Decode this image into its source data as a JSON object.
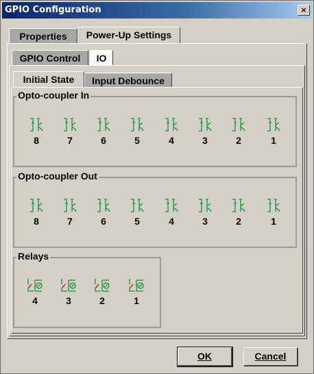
{
  "window": {
    "title": "GPIO Configuration",
    "close_label": "×"
  },
  "tabs": {
    "top": [
      {
        "label": "Properties"
      },
      {
        "label": "Power-Up Settings"
      }
    ],
    "second": [
      {
        "label": "GPIO Control"
      },
      {
        "label": "IO"
      }
    ],
    "third": [
      {
        "label": "Initial State"
      },
      {
        "label": "Input Debounce"
      }
    ]
  },
  "groups": {
    "opto_in": {
      "title": "Opto-coupler In",
      "items": [
        "8",
        "7",
        "6",
        "5",
        "4",
        "3",
        "2",
        "1"
      ]
    },
    "opto_out": {
      "title": "Opto-coupler Out",
      "items": [
        "8",
        "7",
        "6",
        "5",
        "4",
        "3",
        "2",
        "1"
      ]
    },
    "relays": {
      "title": "Relays",
      "items": [
        "4",
        "3",
        "2",
        "1"
      ]
    }
  },
  "buttons": {
    "ok": "OK",
    "cancel": "Cancel"
  },
  "colors": {
    "icon_green": "#2e9a4a",
    "relay_red": "#d42020"
  }
}
